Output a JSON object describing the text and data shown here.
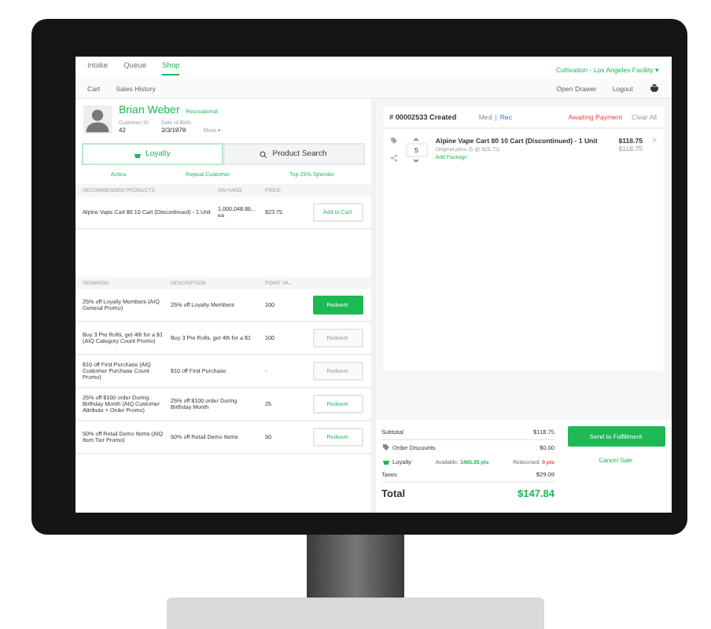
{
  "nav": {
    "tabs": [
      {
        "label": "Intake",
        "selected": false
      },
      {
        "label": "Queue",
        "selected": false
      },
      {
        "label": "Shop",
        "selected": true
      }
    ],
    "facility": "Cultivation - Los Angeles Facility",
    "facility_caret": "▾",
    "subtabs": [
      {
        "label": "Cart"
      },
      {
        "label": "Sales History"
      }
    ],
    "actions": [
      "Open Drawer",
      "Logout"
    ]
  },
  "customer": {
    "name": "Brian Weber",
    "badge": "Recreational",
    "fields": [
      {
        "label": "Customer ID",
        "value": "42"
      },
      {
        "label": "Date of Birth",
        "value": "3/3/1979"
      }
    ],
    "more": "More ▾"
  },
  "panel_tabs": [
    {
      "label": "Loyalty",
      "selected": true
    },
    {
      "label": "Product Search",
      "selected": false
    }
  ],
  "statuses": [
    "Active",
    "Repeat Customer",
    "Top 25% Spender"
  ],
  "recommended": {
    "columns": [
      "RECOMMENDED PRODUCTS",
      "ON HAND",
      "PRICE"
    ],
    "rows": [
      {
        "product": "Alpine Vape Cart 80 10 Cart (Discontinued) - 1 Unit",
        "on_hand": "1,000,048.86...\nea",
        "price": "$23.75",
        "button": "Add to Cart"
      }
    ]
  },
  "rewards": {
    "columns": [
      "REWARDS",
      "DESCRIPTION",
      "POINT VA..."
    ],
    "rows": [
      {
        "reward": "25% off Loyalty Members (AIQ General Promo)",
        "description": "25% off Loyalty Members",
        "points": "100",
        "button": "Redeem",
        "highlighted": true,
        "disabled": false
      },
      {
        "reward": "Buy 3 Pre Rolls, get 4th for a $1 (AIQ Category Count Promo)",
        "description": "Buy 3 Pre Rolls, get 4th for a $1",
        "points": "100",
        "button": "Redeem",
        "highlighted": false,
        "disabled": true
      },
      {
        "reward": "$10 off First Purchase (AIQ Customer Purchase Count Promo)",
        "description": "$10 off First Purchase",
        "points": "-",
        "button": "Redeem",
        "highlighted": false,
        "disabled": true
      },
      {
        "reward": "25% off $100 order During Birthday Month (AIQ Customer Attribute + Order Promo)",
        "description": "25% off $100 order During Birthday Month",
        "points": "25",
        "button": "Redeem",
        "highlighted": false,
        "disabled": false
      },
      {
        "reward": "50% off Retail Demo Items (AIQ Item Tier Promo)",
        "description": "50% off Retail Demo Items",
        "points": "50",
        "button": "Redeem",
        "highlighted": false,
        "disabled": false
      }
    ]
  },
  "order": {
    "title": "# 00002533 Created",
    "types": [
      {
        "label": "Med",
        "selected": false
      },
      {
        "label": "Rec",
        "selected": true
      }
    ],
    "separator": "|",
    "status": "Awaiting Payment",
    "clear": "Clear All",
    "items": [
      {
        "name": "Alpine Vape Cart 80 10 Cart (Discontinued) - 1 Unit",
        "note": "Original price (5 @ $23.75)",
        "link": "Add Package",
        "qty": "5",
        "price": "$118.75",
        "original": "$118.75"
      }
    ]
  },
  "summary": {
    "subtotal": {
      "label": "Subtotal",
      "value": "$118.75"
    },
    "discounts": {
      "label": "Order Discounts",
      "value": "$0.00"
    },
    "loyalty": {
      "label": "Loyalty",
      "available_label": "Available:",
      "available": "1465.35 pts",
      "redeemed_label": "Redeemed:",
      "redeemed": "0 pts"
    },
    "taxes": {
      "label": "Taxes",
      "value": "$29.09"
    },
    "total": {
      "label": "Total",
      "value": "$147.84"
    }
  },
  "buttons": {
    "primary": "Send to Fulfillment",
    "secondary": "Cancel Sale"
  }
}
